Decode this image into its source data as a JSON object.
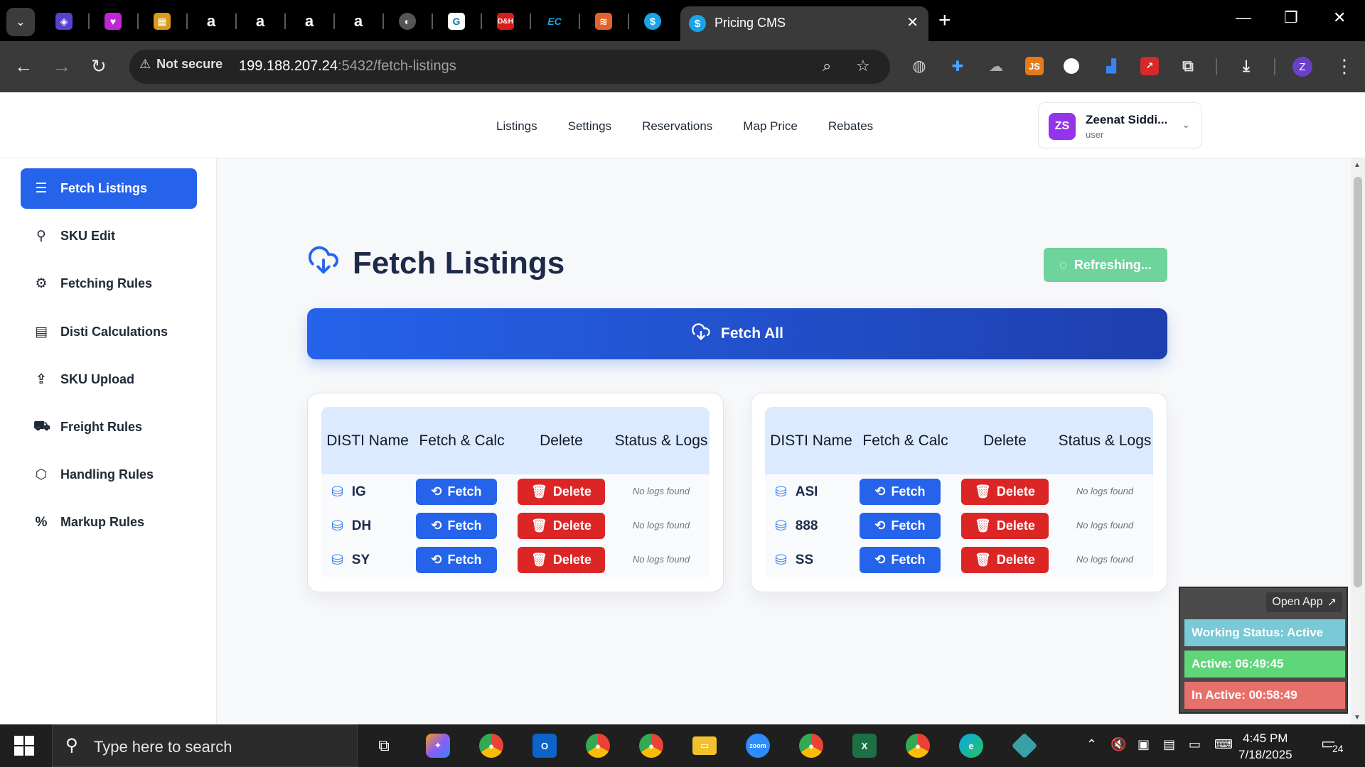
{
  "browser": {
    "active_tab_title": "Pricing CMS",
    "tab_favicon": "dollar-icon",
    "security_label": "Not secure",
    "url_host": "199.188.207.24",
    "url_path": ":5432/fetch-listings",
    "pinned_tabs": [
      "cube-icon",
      "heart-icon",
      "box-icon",
      "amazon-icon",
      "amazon-icon",
      "amazon-icon",
      "amazon-icon",
      "globe-icon",
      "g-icon",
      "dh-icon",
      "ec-icon",
      "stack-icon",
      "dollar-icon"
    ],
    "profile_initial": "Z"
  },
  "topnav": {
    "links": [
      "Listings",
      "Settings",
      "Reservations",
      "Map Price",
      "Rebates"
    ],
    "user": {
      "initials": "ZS",
      "name": "Zeenat Siddi...",
      "role": "user"
    }
  },
  "sidebar": {
    "items": [
      {
        "label": "Fetch Listings",
        "icon": "list-icon",
        "active": true
      },
      {
        "label": "SKU Edit",
        "icon": "search-icon",
        "active": false
      },
      {
        "label": "Fetching Rules",
        "icon": "gear-icon",
        "active": false
      },
      {
        "label": "Disti Calculations",
        "icon": "calculator-icon",
        "active": false
      },
      {
        "label": "SKU Upload",
        "icon": "upload-icon",
        "active": false
      },
      {
        "label": "Freight Rules",
        "icon": "truck-icon",
        "active": false
      },
      {
        "label": "Handling Rules",
        "icon": "package-icon",
        "active": false
      },
      {
        "label": "Markup Rules",
        "icon": "percent-icon",
        "active": false
      }
    ]
  },
  "main": {
    "title": "Fetch Listings",
    "refresh_label": "Refreshing...",
    "fetch_all_label": "Fetch All",
    "columns": [
      "DISTI Name",
      "Fetch & Calc",
      "Delete",
      "Status & Logs"
    ],
    "fetch_label": "Fetch",
    "delete_label": "Delete",
    "tables": [
      {
        "rows": [
          {
            "name": "IG",
            "status": "No logs found"
          },
          {
            "name": "DH",
            "status": "No logs found"
          },
          {
            "name": "SY",
            "status": "No logs found"
          }
        ]
      },
      {
        "rows": [
          {
            "name": "ASI",
            "status": "No logs found"
          },
          {
            "name": "888",
            "status": "No logs found"
          },
          {
            "name": "SS",
            "status": "No logs found"
          }
        ]
      }
    ]
  },
  "widget": {
    "open_app": "Open App",
    "working_status": "Working Status: Active",
    "active_time": "Active: 06:49:45",
    "inactive_time": "In Active: 00:58:49"
  },
  "taskbar": {
    "search_placeholder": "Type here to search",
    "time": "4:45 PM",
    "date": "7/18/2025",
    "notification_count": "24"
  },
  "colors": {
    "primary": "#2563eb",
    "danger": "#dc2626",
    "refresh": "#6fd39c",
    "status_active": "#79c9d6",
    "active_time": "#5fd67a",
    "inactive_time": "#e8706b"
  }
}
